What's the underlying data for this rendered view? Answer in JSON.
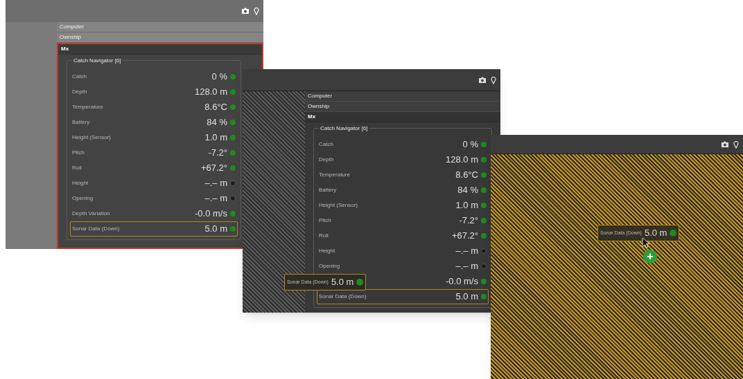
{
  "windows": [
    {
      "kind": "tree",
      "focused": true,
      "tree": [
        {
          "label": "Computer",
          "expanded": false
        },
        {
          "label": "Ownship",
          "expanded": false
        },
        {
          "label": "Mx",
          "expanded": true
        }
      ],
      "group_title": "Catch Navigator [6]",
      "rows": [
        {
          "label": "Catch",
          "value": "0 %",
          "active": true,
          "selected": false
        },
        {
          "label": "Depth",
          "value": "128.0 m",
          "active": true,
          "selected": false
        },
        {
          "label": "Temperature",
          "value": "8.6°C",
          "active": true,
          "selected": false
        },
        {
          "label": "Battery",
          "value": "84 %",
          "active": true,
          "selected": false
        },
        {
          "label": "Height (Sensor)",
          "value": "1.0 m",
          "active": true,
          "selected": false
        },
        {
          "label": "Pitch",
          "value": "-7.2°",
          "active": true,
          "selected": false
        },
        {
          "label": "Roll",
          "value": "+67.2°",
          "active": true,
          "selected": false
        },
        {
          "label": "Height",
          "value": "–.– m",
          "active": false,
          "selected": false
        },
        {
          "label": "Opening",
          "value": "–.– m",
          "active": false,
          "selected": false
        },
        {
          "label": "Depth Variation",
          "value": "-0.0 m/s",
          "active": true,
          "selected": false
        },
        {
          "label": "Sonar Data (Down)",
          "value": "5.0 m",
          "active": true,
          "selected": true
        }
      ]
    },
    {
      "kind": "tree",
      "focused": false,
      "tree": [
        {
          "label": "Computer",
          "expanded": false
        },
        {
          "label": "Ownship",
          "expanded": false
        },
        {
          "label": "Mx",
          "expanded": true
        }
      ],
      "group_title": "Catch Navigator [6]",
      "rows": [
        {
          "label": "Catch",
          "value": "0 %",
          "active": true,
          "selected": false
        },
        {
          "label": "Depth",
          "value": "128.0 m",
          "active": true,
          "selected": false
        },
        {
          "label": "Temperature",
          "value": "8.6°C",
          "active": true,
          "selected": false
        },
        {
          "label": "Battery",
          "value": "84 %",
          "active": true,
          "selected": false
        },
        {
          "label": "Height (Sensor)",
          "value": "1.0 m",
          "active": true,
          "selected": false
        },
        {
          "label": "Pitch",
          "value": "-7.2°",
          "active": true,
          "selected": false
        },
        {
          "label": "Roll",
          "value": "+67.2°",
          "active": true,
          "selected": false
        },
        {
          "label": "Height",
          "value": "–.– m",
          "active": false,
          "selected": false
        },
        {
          "label": "Opening",
          "value": "–.– m",
          "active": false,
          "selected": false
        },
        {
          "value": "-0.0 m/s",
          "active": true,
          "selected": false
        },
        {
          "label": "Sonar Data (Down)",
          "value": "5.0 m",
          "active": true,
          "selected": true
        }
      ],
      "drag_chip": {
        "label": "Sonar Data (Down)",
        "value": "5.0 m",
        "active": true
      }
    },
    {
      "kind": "drop_zone",
      "drag_chip": {
        "label": "Sonar Data (Down)",
        "value": "5.0 m",
        "active": true
      },
      "add_badge": "+"
    }
  ]
}
